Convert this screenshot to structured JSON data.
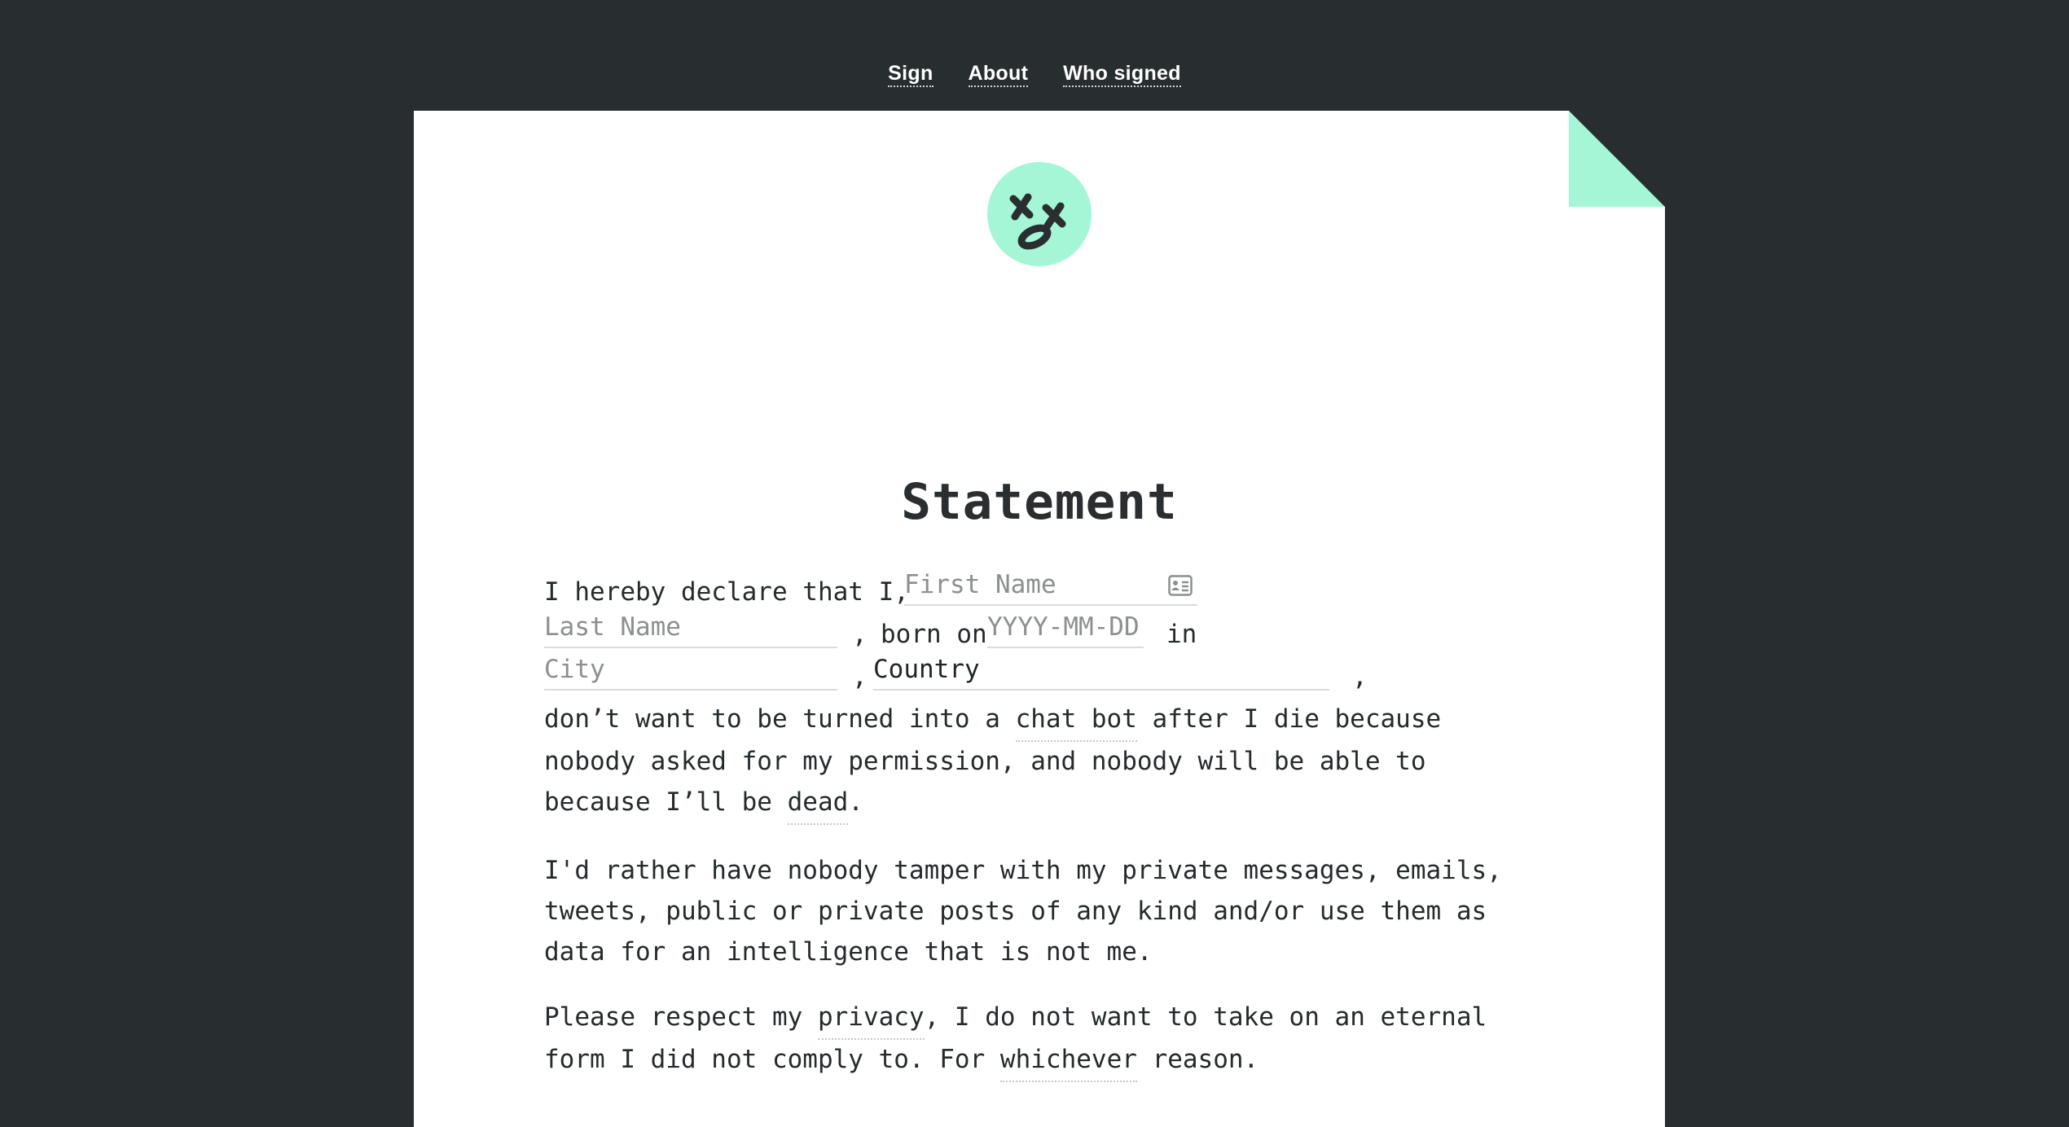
{
  "nav": {
    "sign": "Sign",
    "about": "About",
    "who_signed": "Who signed"
  },
  "colors": {
    "background": "#282d30",
    "paper": "#ffffff",
    "accent": "#a4f6d6",
    "text": "#252a2c"
  },
  "logo": {
    "icon": "dead-face-icon"
  },
  "title": "Statement",
  "form": {
    "intro": "I hereby declare that I,",
    "first_name_placeholder": "First Name",
    "last_name_placeholder": "Last Name",
    "comma1": ",",
    "born_on": "born on",
    "date_placeholder": "YYYY-MM-DD",
    "in": "in",
    "city_placeholder": "City",
    "comma2": ",",
    "country_value": "Country",
    "comma3": ","
  },
  "paragraph1": {
    "l1_a": "don’t want to be turned into a ",
    "l1_link": "chat bot",
    "l1_b": " after I die because",
    "l2": "nobody asked for my permission, and nobody will be able to",
    "l3_a": "because I’ll be ",
    "l3_link": "dead",
    "l3_b": "."
  },
  "paragraph2": {
    "l1": "I'd rather have nobody tamper with my private messages, emails,",
    "l2": "tweets, public or private posts of any kind and/or use them as",
    "l3": "data for an intelligence that is not me."
  },
  "paragraph3": {
    "l1_a": "Please respect my ",
    "l1_link": "privacy",
    "l1_b": ", I do not want to take on an eternal",
    "l2_a": "form I did not comply to. For ",
    "l2_link": "whichever",
    "l2_b": " reason."
  }
}
